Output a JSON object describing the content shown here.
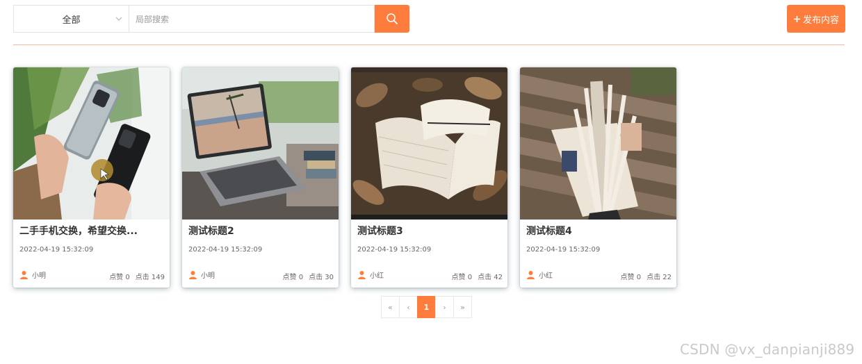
{
  "colors": {
    "accent": "#ff7d3c",
    "divider": "#f4b99c"
  },
  "search": {
    "category_value": "全部",
    "placeholder": "局部搜索",
    "button_icon": "search-icon"
  },
  "publish_button": {
    "icon": "plus-icon",
    "label": "发布内容"
  },
  "cards": [
    {
      "title": "二手手机交换，希望交换...",
      "date": "2022-04-19 15:32:09",
      "author": "小明",
      "likes": "点赞 0",
      "clicks": "点击 149",
      "image": "phones-photo"
    },
    {
      "title": "测试标题2",
      "date": "2022-04-19 15:32:09",
      "author": "小明",
      "likes": "点赞 0",
      "clicks": "点击 30",
      "image": "laptop-photo"
    },
    {
      "title": "测试标题3",
      "date": "2022-04-19 15:32:09",
      "author": "小红",
      "likes": "点赞 0",
      "clicks": "点击 42",
      "image": "book-leaves-photo"
    },
    {
      "title": "测试标题4",
      "date": "2022-04-19 15:32:09",
      "author": "小红",
      "likes": "点赞 0",
      "clicks": "点击 22",
      "image": "book-bench-photo"
    }
  ],
  "pagination": {
    "first": "«",
    "prev": "‹",
    "current": "1",
    "next": "›",
    "last": "»"
  },
  "watermark": "CSDN @vx_danpianji889"
}
